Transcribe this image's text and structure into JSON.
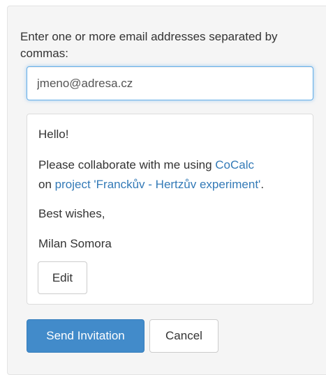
{
  "invite": {
    "prompt": "Enter one or more email addresses separated by commas:",
    "email_value": "jmeno@adresa.cz"
  },
  "message": {
    "greeting": "Hello!",
    "body_prefix": "Please collaborate with me using",
    "app_link": "CoCalc",
    "body_on": "on",
    "project_link": "project 'Franckův - Hertzův experiment'",
    "body_suffix": ".",
    "closing": "Best wishes,",
    "signature": "Milan Somora",
    "edit_label": "Edit"
  },
  "actions": {
    "send_label": "Send Invitation",
    "cancel_label": "Cancel"
  },
  "colors": {
    "primary": "#428bca",
    "link": "#337ab7",
    "focus_border": "#66afe9"
  }
}
